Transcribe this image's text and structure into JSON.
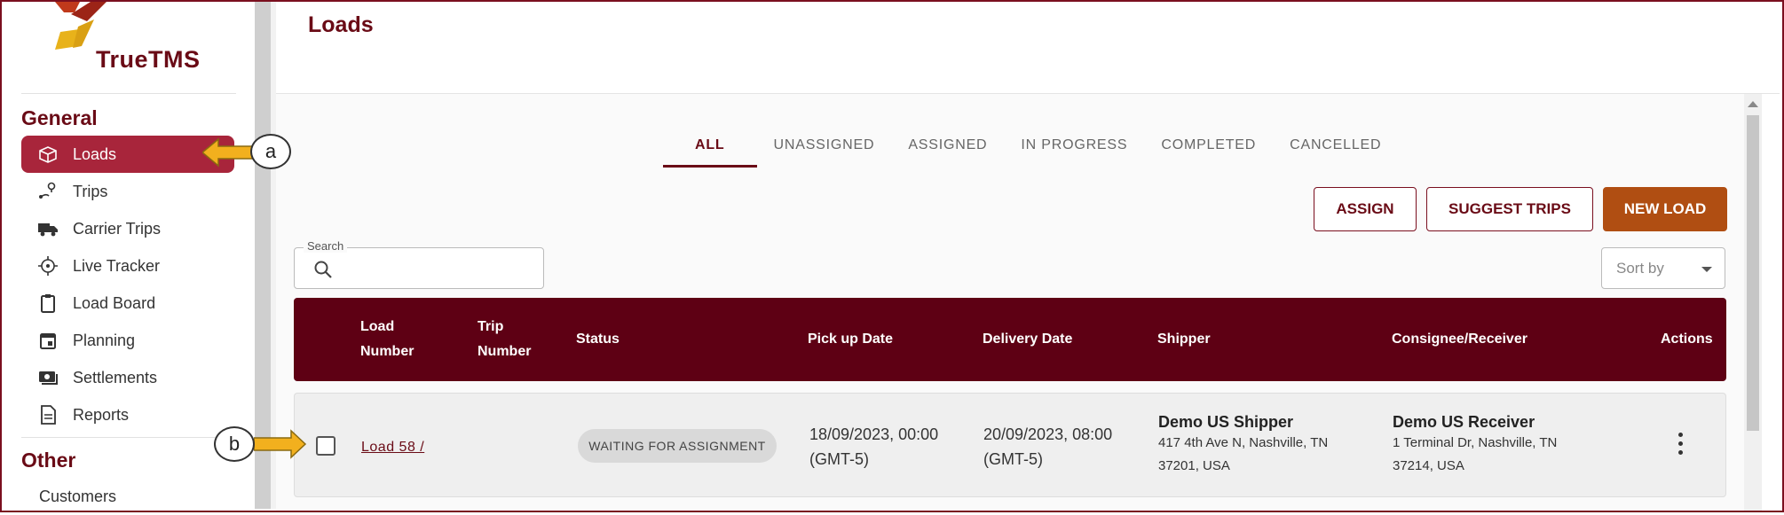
{
  "app": {
    "logo_text": "TrueTMS"
  },
  "page": {
    "title": "Loads"
  },
  "sidebar": {
    "general_title": "General",
    "items": [
      {
        "label": "Loads",
        "icon": "box-icon",
        "active": true
      },
      {
        "label": "Trips",
        "icon": "route-pin-icon"
      },
      {
        "label": "Carrier Trips",
        "icon": "truck-icon"
      },
      {
        "label": "Live Tracker",
        "icon": "crosshair-icon"
      },
      {
        "label": "Load Board",
        "icon": "clipboard-icon"
      },
      {
        "label": "Planning",
        "icon": "calendar-icon"
      },
      {
        "label": "Settlements",
        "icon": "money-icon"
      },
      {
        "label": "Reports",
        "icon": "document-icon"
      }
    ],
    "other_title": "Other",
    "other_items": [
      {
        "label": "Customers"
      }
    ]
  },
  "tabs": [
    "ALL",
    "UNASSIGNED",
    "ASSIGNED",
    "IN PROGRESS",
    "COMPLETED",
    "CANCELLED"
  ],
  "actions": {
    "assign": "ASSIGN",
    "suggest": "SUGGEST TRIPS",
    "new_load": "NEW LOAD"
  },
  "search": {
    "label": "Search",
    "value": ""
  },
  "sort": {
    "label": "Sort by"
  },
  "table": {
    "headers": {
      "load_number_1": "Load",
      "load_number_2": "Number",
      "trip_number_1": "Trip",
      "trip_number_2": "Number",
      "status": "Status",
      "pickup": "Pick up Date",
      "delivery": "Delivery Date",
      "shipper": "Shipper",
      "consignee": "Consignee/Receiver",
      "actions": "Actions"
    },
    "rows": [
      {
        "load": "Load 58 /",
        "trip": "",
        "status": "WAITING FOR ASSIGNMENT",
        "pickup_1": "18/09/2023, 00:00",
        "pickup_2": "(GMT-5)",
        "delivery_1": "20/09/2023, 08:00",
        "delivery_2": "(GMT-5)",
        "shipper_name": "Demo US Shipper",
        "shipper_addr_1": "417 4th Ave N, Nashville, TN",
        "shipper_addr_2": "37201, USA",
        "consignee_name": "Demo US Receiver",
        "consignee_addr_1": "1 Terminal Dr, Nashville, TN",
        "consignee_addr_2": "37214, USA"
      }
    ]
  },
  "callouts": {
    "a": "a",
    "b": "b"
  },
  "colors": {
    "brand": "#6a0b16",
    "active_nav": "#a8253b",
    "header": "#5e0014",
    "primary_button": "#b04e12",
    "callout_arrow": "#f2b01e"
  }
}
